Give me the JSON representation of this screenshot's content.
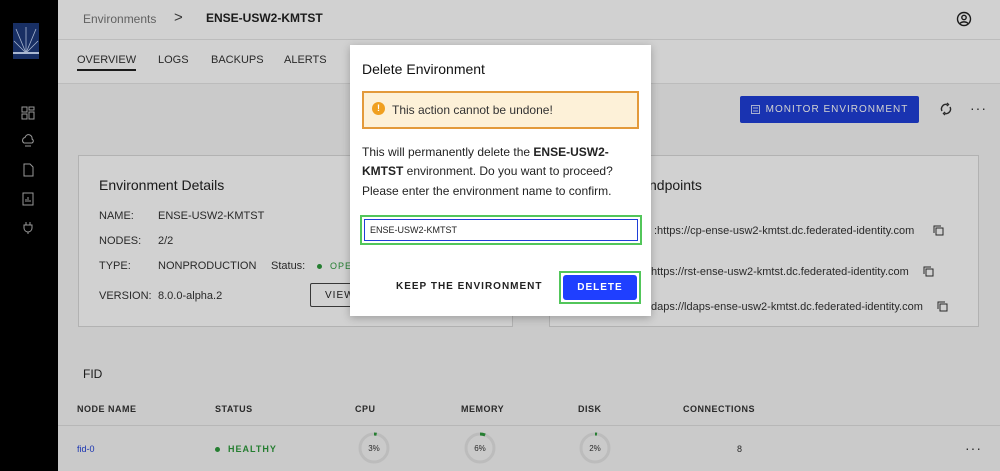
{
  "breadcrumb": {
    "parent": "Environments",
    "separator": ">",
    "current": "ENSE-USW2-KMTST"
  },
  "tabs": [
    "OVERVIEW",
    "LOGS",
    "BACKUPS",
    "ALERTS"
  ],
  "toolbar": {
    "monitor_label": "MONITOR ENVIRONMENT",
    "more": "···"
  },
  "details": {
    "title": "Environment Details",
    "name_label": "NAME:",
    "name_value": "ENSE-USW2-KMTST",
    "nodes_label": "NODES:",
    "nodes_value": "2/2",
    "type_label": "TYPE:",
    "type_value": "NONPRODUCTION",
    "status_label": "Status:",
    "status_value": "OPE",
    "version_label": "VERSION:",
    "version_value": "8.0.0-alpha.2",
    "view_label": "VIEW"
  },
  "endpoints": {
    "title": "ndpoints",
    "items": [
      ":https://cp-ense-usw2-kmtst.dc.federated-identity.com",
      "https://rst-ense-usw2-kmtst.dc.federated-identity.com",
      "daps://ldaps-ense-usw2-kmtst.dc.federated-identity.com"
    ]
  },
  "fid": {
    "title": "FID",
    "columns": [
      "NODE NAME",
      "STATUS",
      "CPU",
      "MEMORY",
      "DISK",
      "CONNECTIONS"
    ],
    "row": {
      "node": "fid-0",
      "status": "HEALTHY",
      "cpu": "3%",
      "memory": "6%",
      "disk": "2%",
      "connections": "8",
      "more": "···"
    },
    "cpu_pct": 3,
    "memory_pct": 6,
    "disk_pct": 2
  },
  "modal": {
    "title": "Delete Environment",
    "warning": "This action cannot be undone!",
    "body_pre": "This will permanently delete the ",
    "body_name": "ENSE-USW2-KMTST",
    "body_post": " environment. Do you want to proceed?",
    "confirm_text": "Please enter the environment name to confirm.",
    "input_value": "ENSE-USW2-KMTST",
    "keep_label": "KEEP THE ENVIRONMENT",
    "delete_label": "DELETE"
  },
  "colors": {
    "accent": "#1f3fd8",
    "healthy": "#2e9a3c",
    "warning_border": "#e39a3b",
    "highlight": "#52c65a"
  }
}
